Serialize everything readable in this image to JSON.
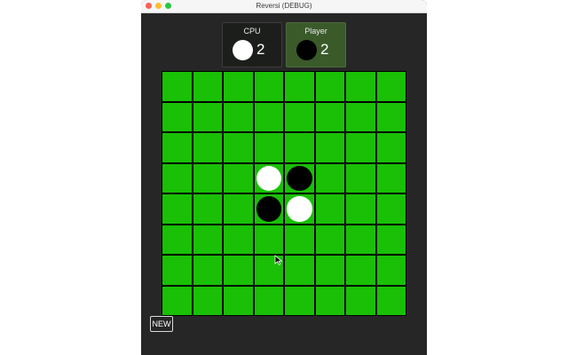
{
  "window": {
    "title": "Reversi (DEBUG)"
  },
  "scoreboard": {
    "cpu": {
      "label": "CPU",
      "count": "2",
      "disc": "white"
    },
    "player": {
      "label": "Player",
      "count": "2",
      "disc": "black"
    }
  },
  "board": {
    "size": 8,
    "rows": [
      [
        "",
        "",
        "",
        "",
        "",
        "",
        "",
        ""
      ],
      [
        "",
        "",
        "",
        "",
        "",
        "",
        "",
        ""
      ],
      [
        "",
        "",
        "",
        "",
        "",
        "",
        "",
        ""
      ],
      [
        "",
        "",
        "",
        "white",
        "black",
        "",
        "",
        ""
      ],
      [
        "",
        "",
        "",
        "black",
        "white",
        "",
        "",
        ""
      ],
      [
        "",
        "",
        "",
        "",
        "",
        "",
        "",
        ""
      ],
      [
        "",
        "",
        "",
        "",
        "",
        "",
        "",
        ""
      ],
      [
        "",
        "",
        "",
        "",
        "",
        "",
        "",
        ""
      ]
    ]
  },
  "controls": {
    "new_label": "NEW"
  },
  "colors": {
    "board_green": "#19c005",
    "active_panel": "#3a5a2a"
  }
}
